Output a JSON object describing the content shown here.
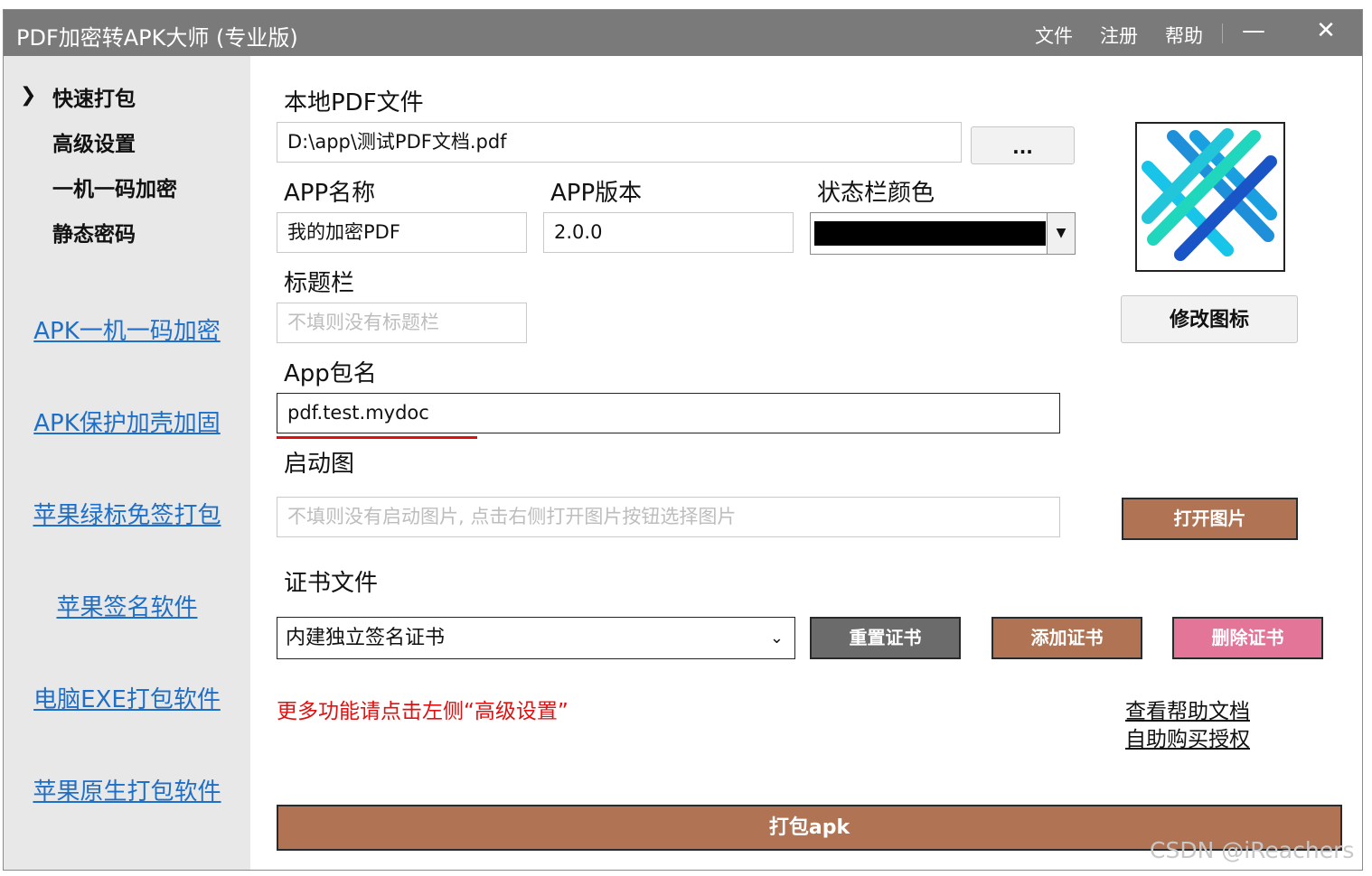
{
  "window": {
    "title": "PDF加密转APK大师 (专业版)",
    "menu": [
      "文件",
      "注册",
      "帮助"
    ],
    "minimize_glyph": "—",
    "close_glyph": "✕"
  },
  "sidebar": {
    "arrow_glyph": "❯",
    "items": [
      "快速打包",
      "高级设置",
      "一机一码加密",
      "静态密码"
    ],
    "links": [
      "APK一机一码加密",
      "APK保护加壳加固",
      "苹果绿标免签打包",
      "苹果签名软件",
      "电脑EXE打包软件",
      "苹果原生打包软件"
    ]
  },
  "form": {
    "local_pdf_label": "本地PDF文件",
    "local_pdf_value": "D:\\app\\测试PDF文档.pdf",
    "browse_label": "...",
    "app_name_label": "APP名称",
    "app_name_value": "我的加密PDF",
    "app_version_label": "APP版本",
    "app_version_value": "2.0.0",
    "status_color_label": "状态栏颜色",
    "status_color": "#000000",
    "title_bar_label": "标题栏",
    "title_bar_placeholder": "不填则没有标题栏",
    "package_label": "App包名",
    "package_value": "pdf.test.mydoc",
    "splash_label": "启动图",
    "splash_placeholder": "不填则没有启动图片, 点击右侧打开图片按钮选择图片",
    "cert_label": "证书文件",
    "cert_value": "内建独立签名证书"
  },
  "buttons": {
    "change_icon": "修改图标",
    "open_image": "打开图片",
    "reset_cert": "重置证书",
    "add_cert": "添加证书",
    "delete_cert": "删除证书",
    "pack": "打包apk"
  },
  "tips": {
    "advanced_hint": "更多功能请点击左侧“高级设置”",
    "help_doc": "查看帮助文档",
    "buy_license": "自助购买授权"
  },
  "watermark": "CSDN @iReachers",
  "colors": {
    "titlebar": "#7a7a7a",
    "sidebar": "#e8e8e8",
    "link": "#1e6fc8",
    "brown_button": "#b07455",
    "grey_button": "#6b6b6b",
    "pink_button": "#e37598",
    "tip_red": "#e01010"
  }
}
